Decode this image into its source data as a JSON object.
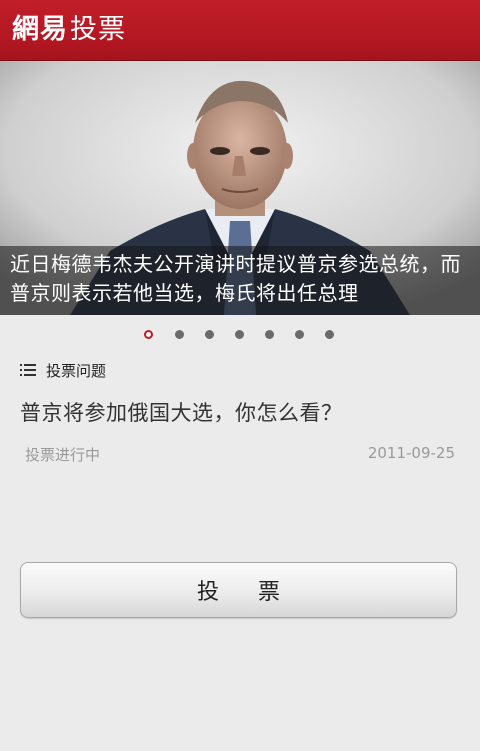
{
  "header": {
    "logo_text": "網易",
    "title": "投票",
    "brand_color": "#b51822"
  },
  "banner": {
    "image": "portrait-photo-of-man-in-suit",
    "caption": "近日梅德韦杰夫公开演讲时提议普京参选总统，而普京则表示若他当选，梅氏将出任总理",
    "page_count": 7,
    "active_page": 1
  },
  "section": {
    "icon": "list-icon",
    "label": "投票问题"
  },
  "poll": {
    "question": "普京将参加俄国大选，你怎么看？",
    "status": "投票进行中",
    "date": "2011-09-25"
  },
  "actions": {
    "vote_label": "投 票"
  }
}
